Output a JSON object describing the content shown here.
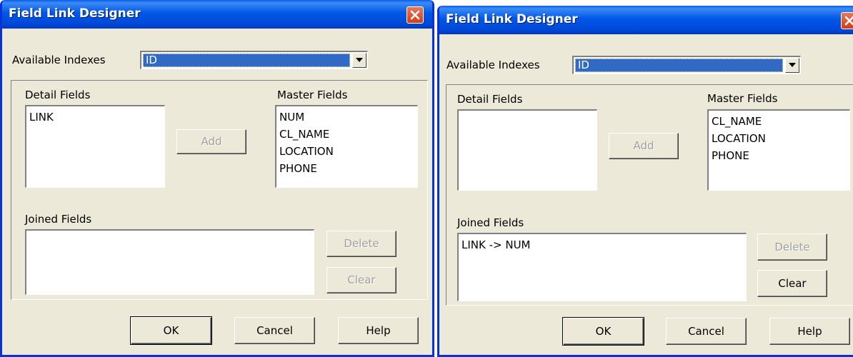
{
  "dialogs": [
    {
      "title": "Field Link Designer",
      "available_indexes_label": "Available Indexes",
      "available_indexes_value": "ID",
      "detail_fields_label": "Detail Fields",
      "detail_fields": [
        "LINK"
      ],
      "master_fields_label": "Master Fields",
      "master_fields": [
        "NUM",
        "CL_NAME",
        "LOCATION",
        "PHONE"
      ],
      "add_label": "Add",
      "joined_fields_label": "Joined Fields",
      "joined_fields": [],
      "delete_label": "Delete",
      "clear_label": "Clear",
      "ok_label": "OK",
      "cancel_label": "Cancel",
      "help_label": "Help"
    },
    {
      "title": "Field Link Designer",
      "available_indexes_label": "Available Indexes",
      "available_indexes_value": "ID",
      "detail_fields_label": "Detail Fields",
      "detail_fields": [],
      "master_fields_label": "Master Fields",
      "master_fields": [
        "CL_NAME",
        "LOCATION",
        "PHONE"
      ],
      "add_label": "Add",
      "joined_fields_label": "Joined Fields",
      "joined_fields": [
        "LINK -> NUM"
      ],
      "delete_label": "Delete",
      "clear_label": "Clear",
      "ok_label": "OK",
      "cancel_label": "Cancel",
      "help_label": "Help"
    }
  ],
  "colors": {
    "title_bar": "#0058e6",
    "dialog_face": "#ece9d8",
    "selection": "#316ac5",
    "close_button": "#d23c16"
  },
  "icons": {
    "close": "close-icon",
    "dropdown": "chevron-down-icon"
  }
}
